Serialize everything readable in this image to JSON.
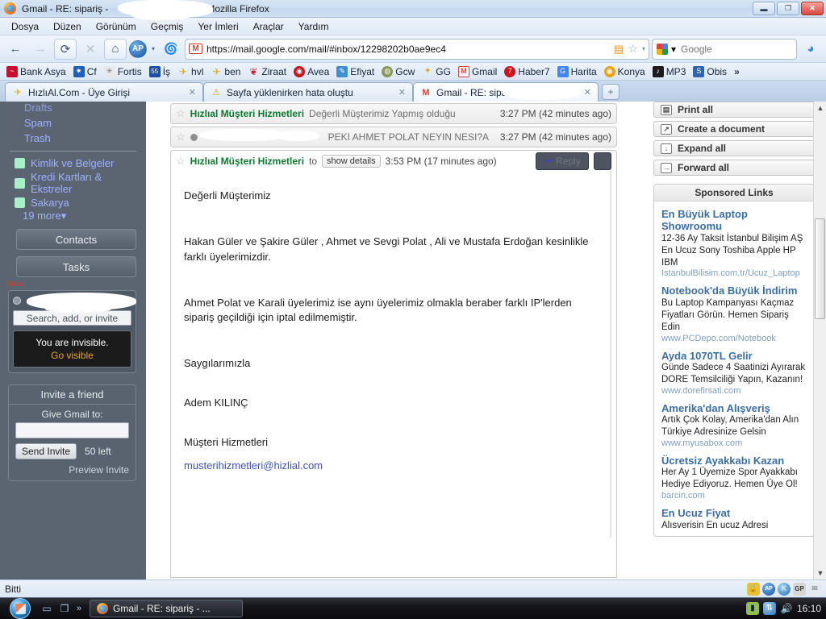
{
  "window": {
    "title": "Gmail - RE: sipariş -",
    "title_suffix": "Mozilla Firefox",
    "minimize_label": "▬",
    "maximize_label": "❐",
    "close_label": "✕"
  },
  "menubar": {
    "items": [
      "Dosya",
      "Düzen",
      "Görünüm",
      "Geçmiş",
      "Yer İmleri",
      "Araçlar",
      "Yardım"
    ]
  },
  "toolbar": {
    "back_label": "←",
    "forward_label": "→",
    "reload_label": "⟳",
    "stop_label": "✕",
    "home_label": "⌂",
    "ap_label": "AP",
    "dropdown_caret": "▾",
    "url": "https://mail.google.com/mail/#inbox/12298202b0ae9ec4",
    "gmail_icon_label": "M",
    "rss_label": "🖻",
    "star_label": "☆",
    "star_caret": "▾",
    "search_placeholder": "Google",
    "search_caret": "▾",
    "skype_label": "S"
  },
  "bookmarks": {
    "items": [
      {
        "label": "Bank Asya",
        "color": "#c8102e",
        "glyph": "~"
      },
      {
        "label": "Cf",
        "color": "#1e5fbd",
        "glyph": "✷"
      },
      {
        "label": "Fortis",
        "color": "#dddddd",
        "glyph": "✳"
      },
      {
        "label": "İş",
        "color": "#1f4fa3",
        "glyph": "55"
      },
      {
        "label": "hvl",
        "color": "#e8b33a",
        "glyph": "✈"
      },
      {
        "label": "ben",
        "color": "#e8b33a",
        "glyph": "✈"
      },
      {
        "label": "Ziraat",
        "color": "#d3202a",
        "glyph": "❦"
      },
      {
        "label": "Avea",
        "color": "#c4161c",
        "glyph": "◉"
      },
      {
        "label": "Efiyat",
        "color": "#3f8fd4",
        "glyph": "✎"
      },
      {
        "label": "Gcw",
        "color": "#8a9a5b",
        "glyph": "◍"
      },
      {
        "label": "GG",
        "color": "#e0a92a",
        "glyph": "卐"
      },
      {
        "label": "Gmail",
        "color": "#d2453a",
        "glyph": "M"
      },
      {
        "label": "Haber7",
        "color": "#d0121b",
        "glyph": "7"
      },
      {
        "label": "Harita",
        "color": "#4285f4",
        "glyph": "G"
      },
      {
        "label": "Konya",
        "color": "#e8a317",
        "glyph": "◉"
      },
      {
        "label": "MP3",
        "color": "#1b1b1b",
        "glyph": "♪"
      },
      {
        "label": "Obis",
        "color": "#2f64b2",
        "glyph": "S"
      }
    ],
    "overflow_label": "»"
  },
  "tabs": [
    {
      "label": "HızlıAl.Com - Üye Girişi",
      "favicon": "✈",
      "close": "✕",
      "active": false,
      "redacted": false
    },
    {
      "label": "Sayfa yüklenirken hata oluştu",
      "favicon": "⚠",
      "close": "✕",
      "active": false,
      "redacted": false
    },
    {
      "label": "Gmail - RE: sipariş -",
      "favicon": "M",
      "close": "✕",
      "active": true,
      "redacted": true
    }
  ],
  "new_tab_label": "+",
  "gmail_nav": {
    "folders": [
      {
        "label": "Drafts",
        "faded": true
      },
      {
        "label": "Spam",
        "faded": false
      },
      {
        "label": "Trash",
        "faded": false
      }
    ],
    "labels": [
      {
        "label": "Kimlik ve Belgeler",
        "color": "#a5f0c7"
      },
      {
        "label": "Kredi Kartları & Ekstreler",
        "color": "#a5f0c7"
      },
      {
        "label": "Sakarya",
        "color": "#a5f0c7"
      }
    ],
    "more_label": "19 more▾",
    "contacts_label": "Contacts",
    "tasks_label": "Tasks",
    "new_badge": "New!",
    "chat_search_placeholder": "Search, add, or invite",
    "invisible_line1": "You are invisible.",
    "invisible_line2": "Go visible",
    "invite_header": "Invite a friend",
    "invite_sub": "Give Gmail to:",
    "invite_value": "",
    "send_invite_label": "Send Invite",
    "invites_left": "50 left",
    "preview_invite_label": "Preview Invite"
  },
  "thread": {
    "messages": [
      {
        "sender": "Hızlıal Müşteri Hizmetleri",
        "snippet": "Değerli Müşterimiz Yapmış olduğu",
        "time": "3:27 PM (42 minutes ago)",
        "star": "☆",
        "redacted": false
      },
      {
        "sender": "",
        "snippet": "PEKI AHMET POLAT NEYIN NESI?A",
        "time": "3:27 PM (42 minutes ago)",
        "star": "☆",
        "redacted": true
      }
    ],
    "open_message": {
      "star": "☆",
      "sender": "Hızlıal Müşteri Hizmetleri",
      "to_label": "to ",
      "show_details_label": "show details",
      "time": "3:53 PM (17 minutes ago)",
      "reply_label": "Reply",
      "reply_arrow": "↩",
      "menu_label": ""
    },
    "body": {
      "greeting": "Değerli Müşterimiz",
      "para1": "Hakan Güler ve Şakire Güler ,  Ahmet ve Sevgi Polat , Ali ve Mustafa Erdoğan kesinlikle farklı üyelerimizdir.",
      "para2": "Ahmet Polat ve Karali üyelerimiz ise aynı üyelerimiz olmakla beraber farklı IP'lerden sipariş geçildiği için iptal edilmemiştir.",
      "closing": "Saygılarımızla",
      "signer": "Adem KILINÇ",
      "dept": "Müşteri Hizmetleri",
      "email": "musterihizmetleri@hizlial.com"
    }
  },
  "right_panel": {
    "actions": [
      {
        "label": "Print all",
        "icon": "🖶"
      },
      {
        "label": "Create a document",
        "icon": "↗"
      },
      {
        "label": "Expand all",
        "icon": "↓"
      },
      {
        "label": "Forward all",
        "icon": "→"
      }
    ],
    "sponsored_header": "Sponsored Links",
    "ads": [
      {
        "title": "En Büyük Laptop Showroomu",
        "desc": "12-36 Ay Taksit İstanbul Bilişim AŞ En Ucuz Sony Toshiba Apple HP IBM",
        "url": "IstanbulBilisim.com.tr/Ucuz_Laptop"
      },
      {
        "title": "Notebook'da Büyük İndirim",
        "desc": "Bu Laptop Kampanyası Kaçmaz Fiyatları Görün. Hemen Sipariş Edin",
        "url": "www.PCDepo.com/Notebook"
      },
      {
        "title": "Ayda 1070TL Gelir",
        "desc": "Günde Sadece 4 Saatinizi Ayırarak DORE Temsilciliği Yapın, Kazanın!",
        "url": "www.dorefirsati.com"
      },
      {
        "title": "Amerika'dan Alışveriş",
        "desc": "Artık Çok Kolay, Amerika'dan Alın Türkiye Adresinize Gelsin",
        "url": "www.myusabox.com"
      },
      {
        "title": "Ücretsiz Ayakkabı Kazan",
        "desc": "Her Ay 1 Üyemize Spor Ayakkabı Hediye Ediyoruz. Hemen Üye Ol!",
        "url": "barcin.com"
      },
      {
        "title": "En Ucuz Fiyat",
        "desc": "Alısverisin En ucuz Adresi",
        "url": ""
      }
    ],
    "scroll_up": "▲",
    "scroll_down": "▼"
  },
  "statusbar": {
    "text": "Bitti",
    "tray": [
      {
        "name": "lock-icon",
        "glyph": "🔒",
        "color": "#e8c03a"
      },
      {
        "name": "ap-icon",
        "glyph": "AP",
        "color": "#2a6fb5"
      },
      {
        "name": "k-icon",
        "glyph": "K",
        "color": "#3f8fd4"
      },
      {
        "name": "gp-icon",
        "glyph": "GP",
        "color": "#bfbfbf"
      },
      {
        "name": "mail-icon",
        "glyph": "✉",
        "color": "#d9dde3"
      }
    ]
  },
  "taskbar": {
    "start_label": "",
    "quicklaunch": [
      {
        "name": "show-desktop-icon",
        "glyph": "▭"
      },
      {
        "name": "switch-window-icon",
        "glyph": "❐"
      }
    ],
    "overflow_label": "»",
    "window_button": "Gmail - RE: sipariş - ...",
    "tray": [
      {
        "name": "network-battery-icon",
        "glyph": "▮",
        "color": "#8fbf4f"
      },
      {
        "name": "network-icon",
        "glyph": "🖧",
        "color": "#3f8fd4"
      },
      {
        "name": "volume-icon",
        "glyph": "🔊",
        "color": "#d9dde3"
      }
    ],
    "clock": "16:10"
  }
}
